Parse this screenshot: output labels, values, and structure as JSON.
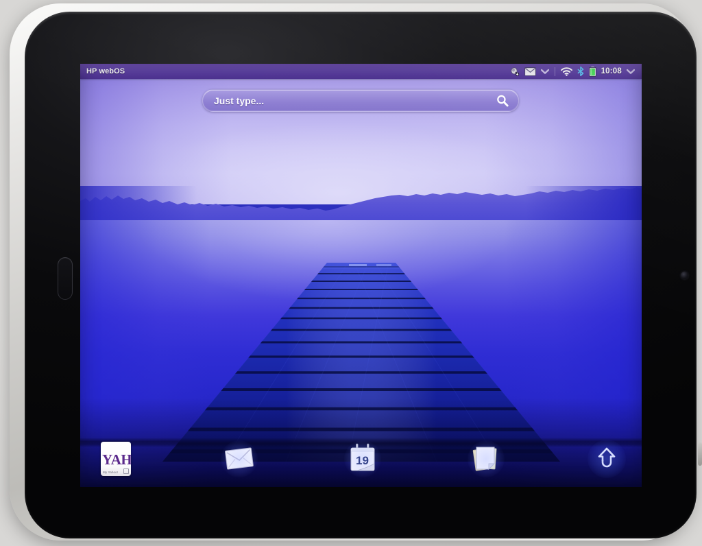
{
  "device": {
    "name": "HP TouchPad tablet",
    "bezel_color": "#0a0a0c",
    "shell_color": "#d9d8d5",
    "home_button_name": "home-button",
    "camera_name": "front-camera"
  },
  "statusbar": {
    "title": "HP webOS",
    "time": "10:08",
    "background_color": "#5a3d9e",
    "icons": [
      {
        "name": "notification-sync-icon",
        "label": "Notification"
      },
      {
        "name": "email-notification-icon",
        "label": "Email"
      },
      {
        "name": "chevron-down-icon",
        "label": "Expand notifications"
      },
      {
        "name": "wifi-icon",
        "label": "Wi-Fi connected"
      },
      {
        "name": "bluetooth-icon",
        "label": "Bluetooth on"
      },
      {
        "name": "battery-icon",
        "label": "Battery full"
      },
      {
        "name": "chevron-down-icon",
        "label": "Expand system menu"
      }
    ],
    "battery_color": "#49e05a"
  },
  "search": {
    "placeholder": "Just type...",
    "value": "",
    "icon": "search-icon",
    "accent_color": "#9b8dda"
  },
  "wallpaper": {
    "scene": "Lake at dusk with wooden pier",
    "sky_color": "#c2baf2",
    "water_color": "#2f2dd4",
    "pier_color": "#1a1f8f"
  },
  "dock": {
    "items": [
      {
        "name": "dock-item-yahoo",
        "label": "Yahoo!",
        "icon": "yahoo-icon",
        "badge_text": "YAH",
        "sub_text": "My Yahoo!"
      },
      {
        "name": "dock-item-email",
        "label": "Email",
        "icon": "envelope-icon"
      },
      {
        "name": "dock-item-calendar",
        "label": "Calendar",
        "icon": "calendar-icon",
        "day": "19"
      },
      {
        "name": "dock-item-memos",
        "label": "Memos",
        "icon": "notes-icon"
      },
      {
        "name": "dock-item-launcher",
        "label": "Launcher",
        "icon": "up-arrow-icon"
      }
    ]
  }
}
